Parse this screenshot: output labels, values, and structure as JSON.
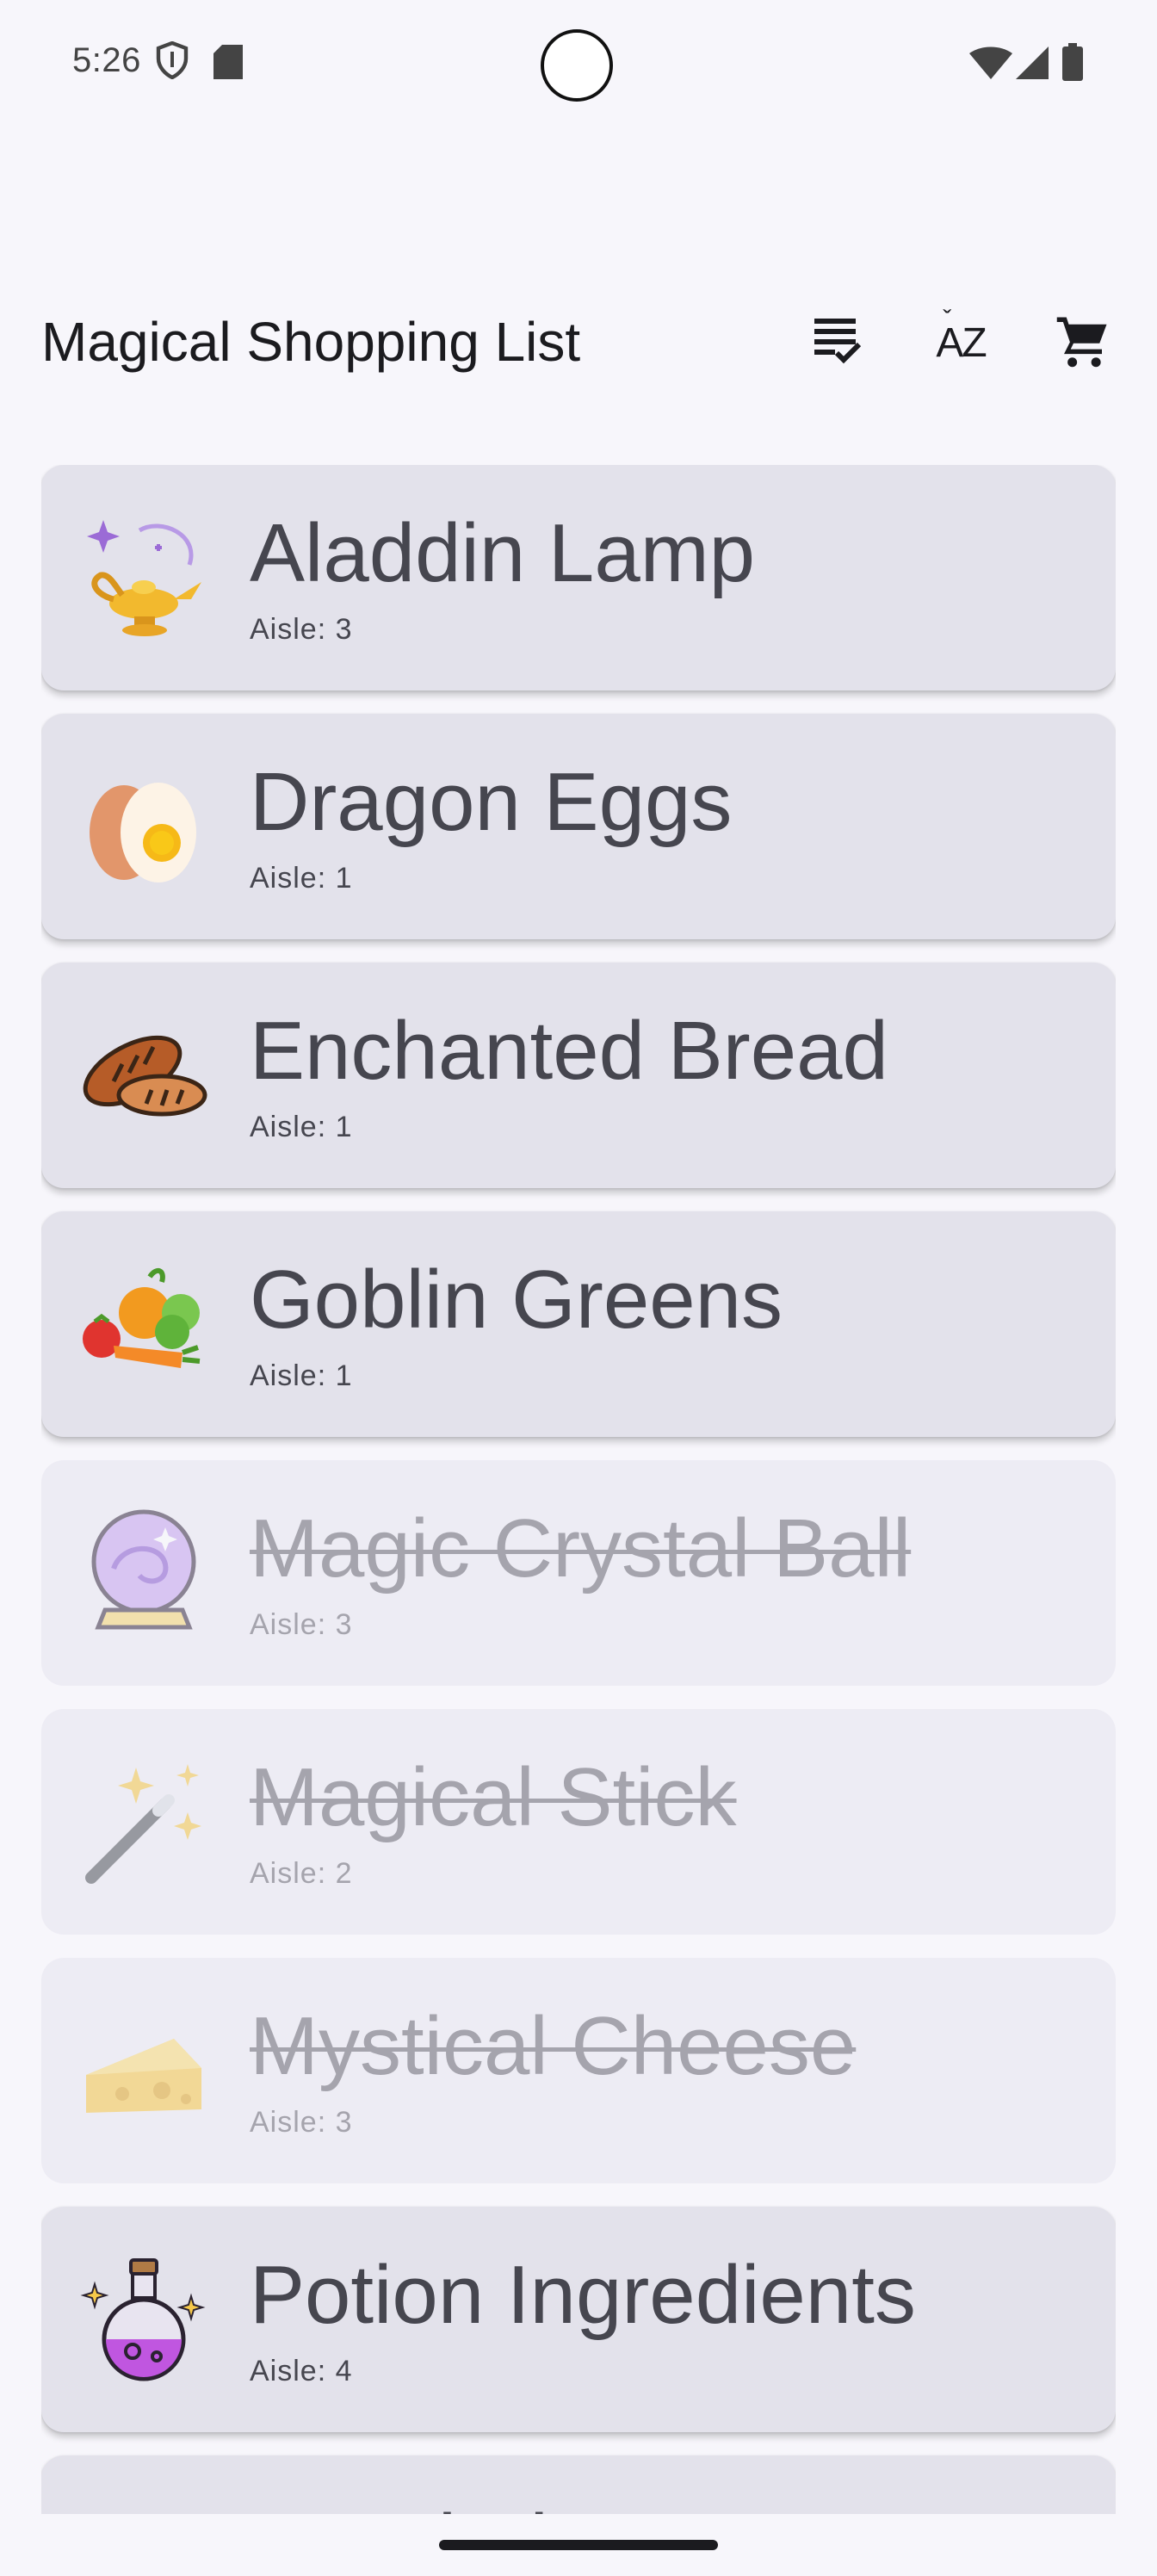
{
  "status": {
    "time": "5:26"
  },
  "appbar": {
    "title": "Magical Shopping List",
    "actions": [
      {
        "name": "checklist-icon"
      },
      {
        "name": "sort-az-icon",
        "label": "AZ"
      },
      {
        "name": "shopping-cart-icon"
      }
    ]
  },
  "items": [
    {
      "name": "Aladdin Lamp",
      "aisle": "Aisle: 3",
      "icon": "magic-lamp-icon",
      "done": false
    },
    {
      "name": "Dragon Eggs",
      "aisle": "Aisle: 1",
      "icon": "egg-icon",
      "done": false
    },
    {
      "name": "Enchanted Bread",
      "aisle": "Aisle: 1",
      "icon": "bread-icon",
      "done": false
    },
    {
      "name": "Goblin Greens",
      "aisle": "Aisle: 1",
      "icon": "vegetables-icon",
      "done": false
    },
    {
      "name": "Magic Crystal Ball",
      "aisle": "Aisle: 3",
      "icon": "crystal-ball-icon",
      "done": true
    },
    {
      "name": "Magical Stick",
      "aisle": "Aisle: 2",
      "icon": "magic-wand-icon",
      "done": true
    },
    {
      "name": "Mystical Cheese",
      "aisle": "Aisle: 3",
      "icon": "cheese-icon",
      "done": true
    },
    {
      "name": "Potion Ingredients",
      "aisle": "Aisle: 4",
      "icon": "potion-icon",
      "done": false
    },
    {
      "name": "Mandrake Root",
      "aisle": "",
      "icon": "sprout-icon",
      "done": false
    }
  ],
  "colors": {
    "background": "#f7f6fb",
    "card": "#e3e2eb",
    "card_done": "#edecf4",
    "text": "#46464f",
    "text_done": "#a5a4ad"
  }
}
